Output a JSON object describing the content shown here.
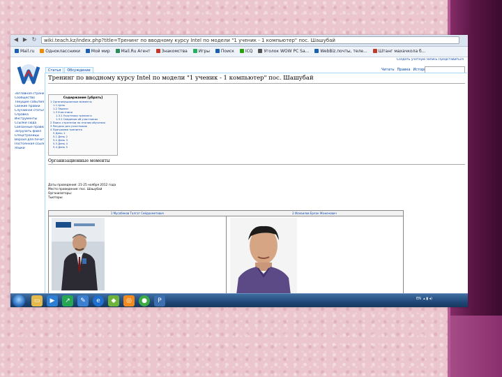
{
  "browser": {
    "url": "wiki.teach.kz/index.php?title=Тренинг по вводному курсу Intel по модели \"1 ученик - 1 компьютер\" пос. Шашубай",
    "bookmarks": [
      "Mail.ru",
      "Одноклассники",
      "Мой мир",
      "Mail.Ru Агент",
      "Знакомства",
      "Игры",
      "Поиск",
      "ICQ",
      "Уголок WOW PC Sa...",
      "WebBiz.почты, теле...",
      "Штанг махачкола б..."
    ]
  },
  "wiki": {
    "top_links": "Создать учётную запись  Представиться",
    "tabs_left": [
      "Статья",
      "Обсуждение"
    ],
    "tabs_right": [
      "Читать",
      "Правка",
      "История"
    ],
    "page_title": "Тренинг по вводному курсу Intel по модели \"1 ученик - 1 компьютер\" пос. Шашубай",
    "sidebar": [
      "Заглавная страница",
      "Сообщество",
      "Текущие события",
      "Свежие правки",
      "Случайная статья",
      "Справка",
      "Инструменты",
      "Ссылки сюда",
      "Связанные правки",
      "Загрузить файл",
      "Спецстраницы",
      "Версия для печати",
      "Постоянная ссылка",
      "Языки"
    ],
    "toc_title": "Содержание [убрать]",
    "toc_items": [
      "1 Организационные моменты",
      "1.1 Цель",
      "1.2 Задачи",
      "1.3 Участники",
      "1.3.1 Участники тренинга",
      "1.3.2 Сведения об участниках",
      "2 Поиск стратегии по этапам обучения",
      "3 Ресурсы для участников",
      "4 Программа тренинга",
      "5 День 1",
      "5.1 День 2",
      "5.2 День 3",
      "5.3 День 4",
      "5.4 День 5"
    ],
    "section_head": "Организационные моменты",
    "info_lines": [
      "Даты проведения: 21-25 ноября 2012 года",
      "Место проведения: пос. Шашубай",
      "Организаторы: ",
      "Тьюторы:"
    ],
    "tutors": [
      "1 Мусабеков Талгат Сейдахметович",
      "2 Исмаилов Ерлан Жакенович"
    ]
  },
  "taskbar": {
    "lang": "EN",
    "icons": [
      "explorer-icon",
      "media-player-icon",
      "chart-icon",
      "paint-icon",
      "ie-icon",
      "forum-icon",
      "ok-icon",
      "chrome-icon",
      "app-icon"
    ]
  }
}
